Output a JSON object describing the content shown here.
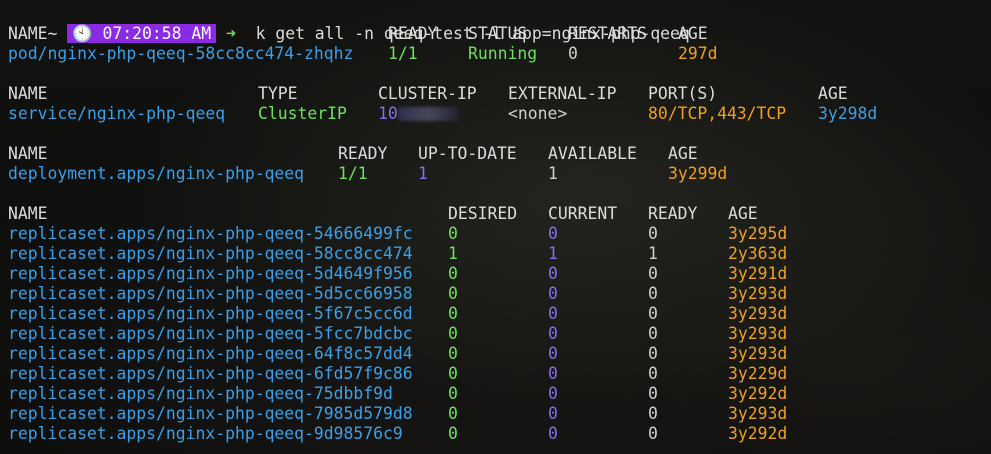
{
  "prompt": {
    "tilde": "~",
    "clock_icon": "clock-icon",
    "time": "07:20:58 AM",
    "arrow": "➜",
    "command": "k get all -n qeeq-test -l app=nginx-php-qeeq"
  },
  "colors": {
    "background": "#0d0d0b",
    "resource_name": "#3aa0e8",
    "ready_value": "#6fe05c",
    "current_value": "#8a6cf0",
    "age_value": "#f0a020",
    "badge": "#8a2be2"
  },
  "pods": {
    "headers": [
      "NAME",
      "READY",
      "STATUS",
      "RESTARTS",
      "AGE"
    ],
    "rows": [
      {
        "name": "pod/nginx-php-qeeq-58cc8cc474-zhqhz",
        "ready": "1/1",
        "status": "Running",
        "restarts": "0",
        "age": "297d"
      }
    ]
  },
  "services": {
    "headers": [
      "NAME",
      "TYPE",
      "CLUSTER-IP",
      "EXTERNAL-IP",
      "PORT(S)",
      "AGE"
    ],
    "rows": [
      {
        "name": "service/nginx-php-qeeq",
        "type": "ClusterIP",
        "cluster_ip": "10",
        "external_ip": "<none>",
        "ports": "80/TCP,443/TCP",
        "age": "3y298d"
      }
    ]
  },
  "deployments": {
    "headers": [
      "NAME",
      "READY",
      "UP-TO-DATE",
      "AVAILABLE",
      "AGE"
    ],
    "rows": [
      {
        "name": "deployment.apps/nginx-php-qeeq",
        "ready": "1/1",
        "up_to_date": "1",
        "available": "1",
        "age": "3y299d"
      }
    ]
  },
  "replicasets": {
    "headers": [
      "NAME",
      "DESIRED",
      "CURRENT",
      "READY",
      "AGE"
    ],
    "rows": [
      {
        "name": "replicaset.apps/nginx-php-qeeq-54666499fc",
        "desired": "0",
        "current": "0",
        "ready": "0",
        "age": "3y295d"
      },
      {
        "name": "replicaset.apps/nginx-php-qeeq-58cc8cc474",
        "desired": "1",
        "current": "1",
        "ready": "1",
        "age": "2y363d"
      },
      {
        "name": "replicaset.apps/nginx-php-qeeq-5d4649f956",
        "desired": "0",
        "current": "0",
        "ready": "0",
        "age": "3y291d"
      },
      {
        "name": "replicaset.apps/nginx-php-qeeq-5d5cc66958",
        "desired": "0",
        "current": "0",
        "ready": "0",
        "age": "3y293d"
      },
      {
        "name": "replicaset.apps/nginx-php-qeeq-5f67c5cc6d",
        "desired": "0",
        "current": "0",
        "ready": "0",
        "age": "3y293d"
      },
      {
        "name": "replicaset.apps/nginx-php-qeeq-5fcc7bdcbc",
        "desired": "0",
        "current": "0",
        "ready": "0",
        "age": "3y293d"
      },
      {
        "name": "replicaset.apps/nginx-php-qeeq-64f8c57dd4",
        "desired": "0",
        "current": "0",
        "ready": "0",
        "age": "3y293d"
      },
      {
        "name": "replicaset.apps/nginx-php-qeeq-6fd57f9c86",
        "desired": "0",
        "current": "0",
        "ready": "0",
        "age": "3y229d"
      },
      {
        "name": "replicaset.apps/nginx-php-qeeq-75dbbf9d",
        "desired": "0",
        "current": "0",
        "ready": "0",
        "age": "3y292d"
      },
      {
        "name": "replicaset.apps/nginx-php-qeeq-7985d579d8",
        "desired": "0",
        "current": "0",
        "ready": "0",
        "age": "3y293d"
      },
      {
        "name": "replicaset.apps/nginx-php-qeeq-9d98576c9",
        "desired": "0",
        "current": "0",
        "ready": "0",
        "age": "3y292d"
      }
    ]
  }
}
